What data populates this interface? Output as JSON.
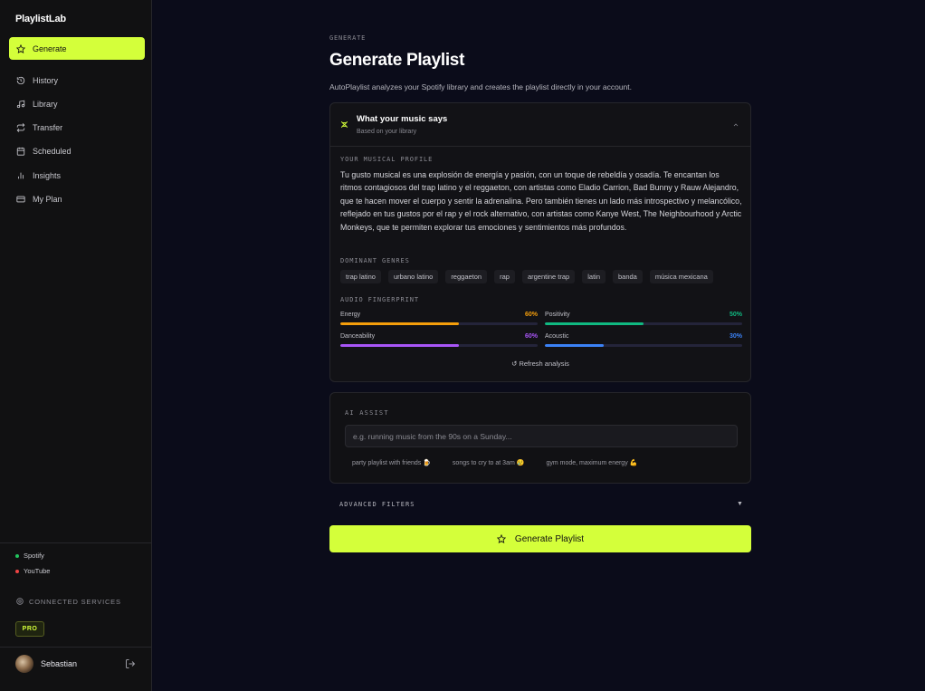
{
  "app": {
    "name": "PlaylistLab"
  },
  "sidebar": {
    "items": [
      {
        "label": "Generate",
        "icon": "star-icon"
      },
      {
        "label": "History",
        "icon": "history-icon"
      },
      {
        "label": "Library",
        "icon": "music-note-icon"
      },
      {
        "label": "Transfer",
        "icon": "transfer-icon"
      },
      {
        "label": "Scheduled",
        "icon": "calendar-icon"
      },
      {
        "label": "Insights",
        "icon": "bar-chart-icon"
      },
      {
        "label": "My Plan",
        "icon": "card-icon"
      }
    ],
    "services": [
      {
        "label": "Spotify",
        "color": "#22c55e"
      },
      {
        "label": "YouTube",
        "color": "#ef4444"
      }
    ],
    "connected_label": "CONNECTED SERVICES",
    "plan_badge": "PRO",
    "user": {
      "name": "Sebastian"
    }
  },
  "header": {
    "breadcrumb": "GENERATE",
    "title": "Generate Playlist",
    "subtitle": "AutoPlaylist analyzes your Spotify library and creates the playlist directly in your account."
  },
  "analysis": {
    "title": "What your music says",
    "subtitle": "Based on your library",
    "profile_label": "YOUR MUSICAL PROFILE",
    "profile_text": "Tu gusto musical es una explosión de energía y pasión, con un toque de rebeldía y osadía. Te encantan los ritmos contagiosos del trap latino y el reggaeton, con artistas como Eladio Carrion, Bad Bunny y Rauw Alejandro, que te hacen mover el cuerpo y sentir la adrenalina. Pero también tienes un lado más introspectivo y melancólico, reflejado en tus gustos por el rap y el rock alternativo, con artistas como Kanye West, The Neighbourhood y Arctic Monkeys, que te permiten explorar tus emociones y sentimientos más profundos.",
    "genres_label": "DOMINANT GENRES",
    "genres": [
      "trap latino",
      "urbano latino",
      "reggaeton",
      "rap",
      "argentine trap",
      "latin",
      "banda",
      "música mexicana"
    ],
    "fingerprint_label": "AUDIO FINGERPRINT",
    "metrics": [
      {
        "name": "Energy",
        "value": "60%",
        "fraction": 0.6,
        "color": "#f59e0b"
      },
      {
        "name": "Positivity",
        "value": "50%",
        "fraction": 0.5,
        "color": "#10b981"
      },
      {
        "name": "Danceability",
        "value": "60%",
        "fraction": 0.6,
        "color": "#a855f7"
      },
      {
        "name": "Acoustic",
        "value": "30%",
        "fraction": 0.3,
        "color": "#3b82f6"
      }
    ],
    "refresh_label": "↺ Refresh analysis"
  },
  "ai_assist": {
    "label": "AI ASSIST",
    "value": "",
    "placeholder": "e.g. running music from the 90s on a Sunday...",
    "suggestions": [
      "party playlist with friends 🍺",
      "songs to cry to at 3am 😢",
      "gym mode, maximum energy 💪"
    ]
  },
  "filters": {
    "label": "ADVANCED FILTERS",
    "arrow": "▼"
  },
  "generate_button": {
    "label": "Generate Playlist"
  },
  "colors": {
    "accent": "#d4ff3a",
    "background": "#0b0c1a",
    "sidebar": "#111112"
  }
}
